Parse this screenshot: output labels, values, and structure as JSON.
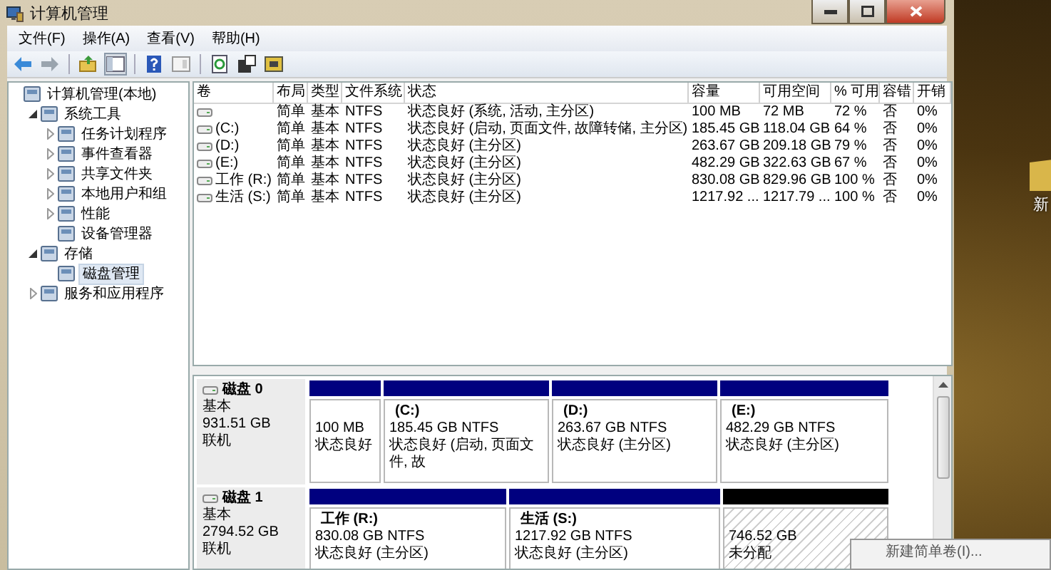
{
  "window": {
    "title": "计算机管理"
  },
  "menu": [
    "文件(F)",
    "操作(A)",
    "查看(V)",
    "帮助(H)"
  ],
  "tree": [
    {
      "label": "计算机管理(本地)",
      "selected": false,
      "children": [
        {
          "label": "系统工具",
          "expanded": true,
          "selected": false,
          "children": [
            {
              "label": "任务计划程序",
              "expanded": false,
              "selected": false
            },
            {
              "label": "事件查看器",
              "expanded": false,
              "selected": false
            },
            {
              "label": "共享文件夹",
              "expanded": false,
              "selected": false
            },
            {
              "label": "本地用户和组",
              "expanded": false,
              "selected": false
            },
            {
              "label": "性能",
              "expanded": false,
              "selected": false
            },
            {
              "label": "设备管理器",
              "selected": false
            }
          ]
        },
        {
          "label": "存储",
          "expanded": true,
          "selected": false,
          "children": [
            {
              "label": "磁盘管理",
              "selected": true
            }
          ]
        },
        {
          "label": "服务和应用程序",
          "expanded": false,
          "selected": false
        }
      ]
    }
  ],
  "table": {
    "columns": [
      "卷",
      "布局",
      "类型",
      "文件系统",
      "状态",
      "容量",
      "可用空间",
      "% 可用",
      "容错",
      "开销"
    ],
    "rows": [
      {
        "layout": "简单",
        "type": "基本",
        "filesystem": "NTFS",
        "status": "状态良好 (系统, 活动, 主分区)",
        "capacity": "100 MB",
        "free": "72 MB",
        "percent_free": "72 %",
        "fault_tolerance": "否",
        "overhead": "0%"
      },
      {
        "volume": "(C:)",
        "layout": "简单",
        "type": "基本",
        "filesystem": "NTFS",
        "status": "状态良好 (启动, 页面文件, 故障转储, 主分区)",
        "capacity": "185.45 GB",
        "free": "118.04 GB",
        "percent_free": "64 %",
        "fault_tolerance": "否",
        "overhead": "0%"
      },
      {
        "volume": "(D:)",
        "layout": "简单",
        "type": "基本",
        "filesystem": "NTFS",
        "status": "状态良好 (主分区)",
        "capacity": "263.67 GB",
        "free": "209.18 GB",
        "percent_free": "79 %",
        "fault_tolerance": "否",
        "overhead": "0%"
      },
      {
        "volume": "(E:)",
        "layout": "简单",
        "type": "基本",
        "filesystem": "NTFS",
        "status": "状态良好 (主分区)",
        "capacity": "482.29 GB",
        "free": "322.63 GB",
        "percent_free": "67 %",
        "fault_tolerance": "否",
        "overhead": "0%"
      },
      {
        "volume": "工作 (R:)",
        "layout": "简单",
        "type": "基本",
        "filesystem": "NTFS",
        "status": "状态良好 (主分区)",
        "capacity": "830.08 GB",
        "free": "829.96 GB",
        "percent_free": "100 %",
        "fault_tolerance": "否",
        "overhead": "0%"
      },
      {
        "volume": "生活 (S:)",
        "layout": "简单",
        "type": "基本",
        "filesystem": "NTFS",
        "status": "状态良好 (主分区)",
        "capacity": "1217.92 ...",
        "free": "1217.79 ...",
        "percent_free": "100 %",
        "fault_tolerance": "否",
        "overhead": "0%"
      }
    ]
  },
  "disks": [
    {
      "name": "磁盘 0",
      "type": "基本",
      "size": "931.51 GB",
      "status": "联机",
      "partitions": [
        {
          "kind": "primary",
          "size": "100 MB",
          "status": "状态良好"
        },
        {
          "kind": "primary",
          "label": "(C:)",
          "size": "185.45 GB NTFS",
          "status": "状态良好 (启动, 页面文件, 故"
        },
        {
          "kind": "primary",
          "label": "(D:)",
          "size": "263.67 GB NTFS",
          "status": "状态良好 (主分区)"
        },
        {
          "kind": "primary",
          "label": "(E:)",
          "size": "482.29 GB NTFS",
          "status": "状态良好 (主分区)"
        }
      ]
    },
    {
      "name": "磁盘 1",
      "type": "基本",
      "size": "2794.52 GB",
      "status": "联机",
      "partitions": [
        {
          "kind": "primary",
          "label": "工作 (R:)",
          "size": "830.08 GB NTFS",
          "status": "状态良好 (主分区)"
        },
        {
          "kind": "primary",
          "label": "生活 (S:)",
          "size": "1217.92 GB NTFS",
          "status": "状态良好 (主分区)"
        },
        {
          "kind": "unallocated",
          "size": "746.52 GB",
          "status": "未分配"
        }
      ]
    }
  ],
  "context_menu": [
    "新建简单卷(I)..."
  ],
  "desktop_icon": {
    "label": "新"
  }
}
